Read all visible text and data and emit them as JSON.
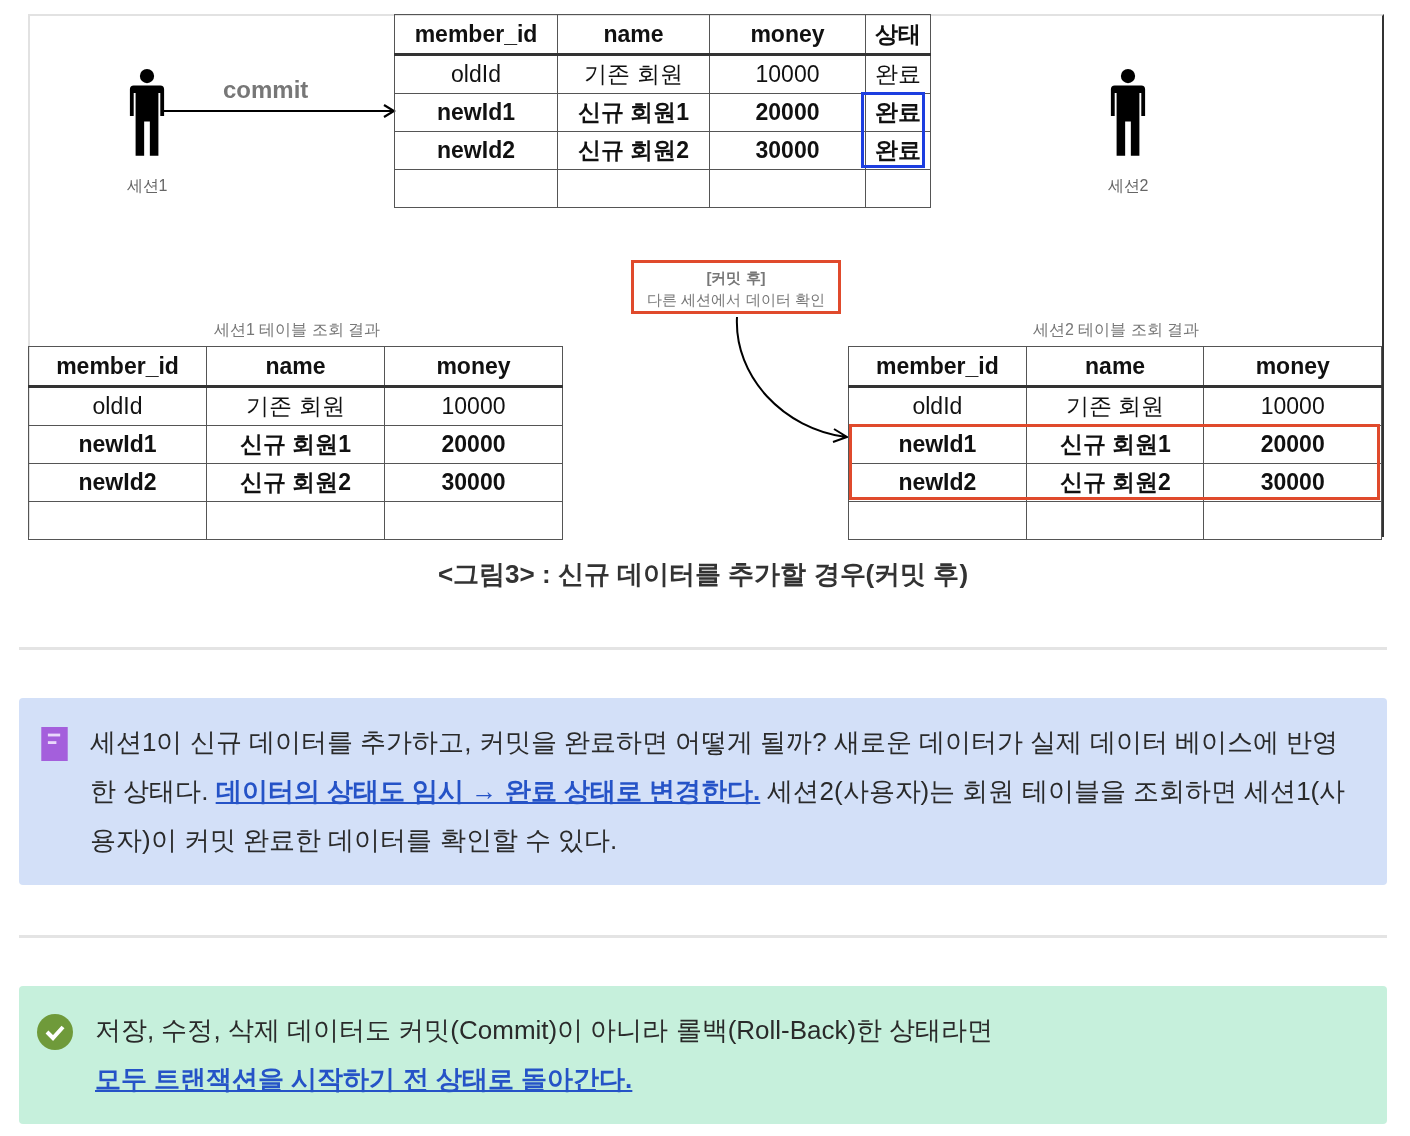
{
  "figure": {
    "sessions": [
      {
        "label": "세션1"
      },
      {
        "label": "세션2"
      }
    ],
    "commit_label": "commit",
    "main_table": {
      "columns": [
        "member_id",
        "name",
        "money",
        "상태"
      ],
      "rows": [
        {
          "cells": [
            "oldId",
            "기존 회원",
            "10000",
            "완료"
          ],
          "bold": false,
          "highlighted": false
        },
        {
          "cells": [
            "newId1",
            "신규 회원1",
            "20000",
            "완료"
          ],
          "bold": true,
          "highlighted": true
        },
        {
          "cells": [
            "newId2",
            "신규 회원2",
            "30000",
            "완료"
          ],
          "bold": true,
          "highlighted": true
        }
      ]
    },
    "note": {
      "title": "[커밋 후]",
      "text": "다른 세션에서 데이터 확인"
    },
    "result_tables": [
      {
        "caption": "세션1 테이블 조회 결과",
        "columns": [
          "member_id",
          "name",
          "money"
        ],
        "rows": [
          {
            "cells": [
              "oldId",
              "기존 회원",
              "10000"
            ],
            "bold": false,
            "highlighted": false
          },
          {
            "cells": [
              "newId1",
              "신규 회원1",
              "20000"
            ],
            "bold": true,
            "highlighted": false
          },
          {
            "cells": [
              "newId2",
              "신규 회원2",
              "30000"
            ],
            "bold": true,
            "highlighted": false
          }
        ]
      },
      {
        "caption": "세션2 테이블 조회 결과",
        "columns": [
          "member_id",
          "name",
          "money"
        ],
        "rows": [
          {
            "cells": [
              "oldId",
              "기존 회원",
              "10000"
            ],
            "bold": false,
            "highlighted": false
          },
          {
            "cells": [
              "newId1",
              "신규 회원1",
              "20000"
            ],
            "bold": true,
            "highlighted": true
          },
          {
            "cells": [
              "newId2",
              "신규 회원2",
              "30000"
            ],
            "bold": true,
            "highlighted": true
          }
        ]
      }
    ],
    "caption": "<그림3> : 신규 데이터를 추가할 경우(커밋 후)"
  },
  "callouts": [
    {
      "kind": "note",
      "segments": [
        {
          "text": "세션1이 신규 데이터를 추가하고, 커밋을 완료하면 어떻게 될까? 새로운 데이터가 실제 데이터 베이스에 반영한 상태다. "
        },
        {
          "text": "데이터의 상태도 임시 → 완료 상태로 변경한다.",
          "link": true
        },
        {
          "text": " 세션2(사용자)는 회원 테이블을 조회하면 세션1(사용자)이 커밋 완료한 데이터를 확인할 수 있다."
        }
      ]
    },
    {
      "kind": "success",
      "segments": [
        {
          "text": "저장, 수정, 삭제 데이터도 커밋(Commit)이 아니라 롤백(Roll-Back)한 상태라면 "
        },
        {
          "text": "모두 트랜잭션을 시작하기 전 상태로 돌아간다.",
          "link": true
        }
      ]
    }
  ]
}
